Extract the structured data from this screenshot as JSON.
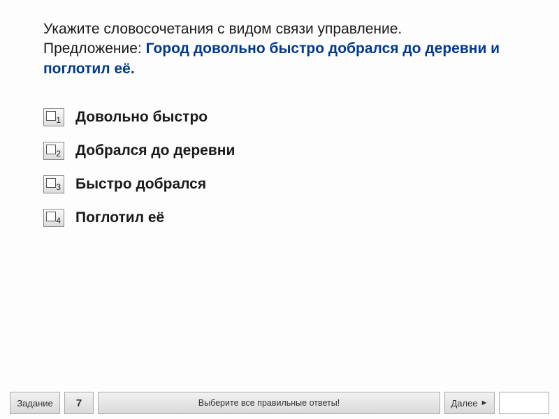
{
  "question": {
    "prompt": "Укажите словосочетания с видом связи управление.",
    "sentence_label": "Предложение: ",
    "sentence": "Город довольно быстро добрался до деревни и поглотил её."
  },
  "options": [
    {
      "num": "1",
      "label": "Довольно быстро"
    },
    {
      "num": "2",
      "label": "Добрался до деревни"
    },
    {
      "num": "3",
      "label": "Быстро добрался"
    },
    {
      "num": "4",
      "label": "Поглотил её"
    }
  ],
  "footer": {
    "task_label": "Задание",
    "task_num": "7",
    "hint": "Выберите все правильные ответы!",
    "next": "Далее",
    "arrow": "►"
  }
}
